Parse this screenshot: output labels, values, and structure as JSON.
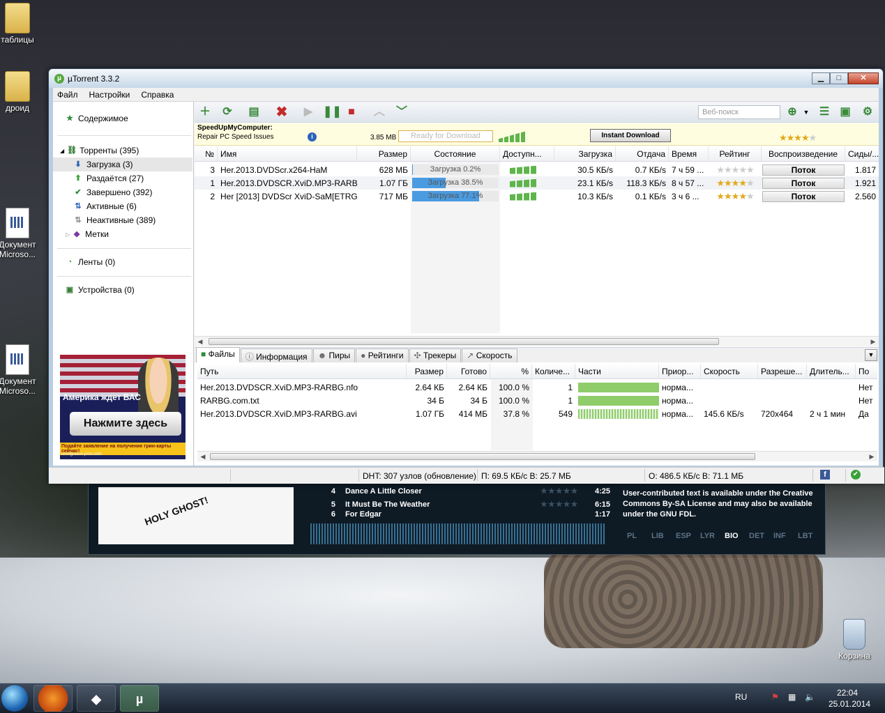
{
  "desktop": {
    "icons": [
      {
        "label": "таблицы"
      },
      {
        "label": "дроид"
      },
      {
        "label": "Документ Microso..."
      },
      {
        "label": "Документ Microso..."
      },
      {
        "label": "Корзина"
      }
    ]
  },
  "player": {
    "tracks": [
      {
        "num": "4",
        "title": "Dance A Little Closer",
        "duration": "4:25"
      },
      {
        "num": "5",
        "title": "It Must Be The Weather",
        "duration": "6:15"
      },
      {
        "num": "6",
        "title": "For Edgar",
        "duration": "1:17"
      }
    ],
    "bio_text": "User-contributed text is available under the Creative Commons By-SA License and may also be available under the GNU FDL.",
    "tabs": [
      "PL",
      "LIB",
      "ESP",
      "LYR",
      "BIO",
      "DET",
      "INF",
      "LBT"
    ],
    "active_tab": "BIO",
    "cover_text": "HOLY GHOST!"
  },
  "window": {
    "title": "µTorrent 3.3.2",
    "menu": [
      "Файл",
      "Настройки",
      "Справка"
    ],
    "search_placeholder": "Веб-поиск"
  },
  "sidebar": {
    "content": "Содержимое",
    "torrents": "Торренты (395)",
    "items": [
      {
        "label": "Загрузка (3)",
        "selected": true
      },
      {
        "label": "Раздаётся (27)"
      },
      {
        "label": "Завершено (392)"
      },
      {
        "label": "Активные (6)"
      },
      {
        "label": "Неактивные (389)"
      },
      {
        "label": "Метки"
      }
    ],
    "feeds": "Ленты (0)",
    "devices": "Устройства (0)",
    "ad": {
      "headline": "Америка ждет ВАС",
      "button": "Нажмите здесь",
      "footer": "Подайте заявление на получение грин-карты сейчас!",
      "site": "immigration-pros.com"
    }
  },
  "adbar": {
    "line1": "SpeedUpMyComputer:",
    "line2": "Repair PC Speed Issues",
    "size": "3.85 MB",
    "ready": "Ready for Download",
    "instant": "Instant Download",
    "rating": 4
  },
  "torrent_table": {
    "columns": [
      "№",
      "Имя",
      "Размер",
      "Состояние",
      "Доступн...",
      "Загрузка",
      "Отдача",
      "Время",
      "Рейтинг",
      "Воспроизведение",
      "Сиды/..."
    ],
    "rows": [
      {
        "num": "3",
        "name": "Her.2013.DVDScr.x264-HaM",
        "size": "628 МБ",
        "status": "Загрузка 0.2%",
        "progress": 0.002,
        "down": "30.5 КБ/s",
        "up": "0.7 КБ/s",
        "eta": "7 ч 59 ...",
        "rating": 0,
        "play": "Поток",
        "seeds": "1.817"
      },
      {
        "num": "1",
        "name": "Her.2013.DVDSCR.XviD.MP3-RARBG",
        "size": "1.07 ГБ",
        "status": "Загрузка 38.5%",
        "progress": 0.385,
        "down": "23.1 КБ/s",
        "up": "118.3 КБ/s",
        "eta": "8 ч 57 ...",
        "rating": 4,
        "play": "Поток",
        "seeds": "1.921"
      },
      {
        "num": "2",
        "name": "Her [2013] DVDScr XviD-SaM[ETRG]",
        "size": "717 МБ",
        "status": "Загрузка 77.1%",
        "progress": 0.771,
        "down": "10.3 КБ/s",
        "up": "0.1 КБ/s",
        "eta": "3 ч 6 ...",
        "rating": 4,
        "play": "Поток",
        "seeds": "2.560"
      }
    ]
  },
  "panel_tabs": [
    "Файлы",
    "Информация",
    "Пиры",
    "Рейтинги",
    "Трекеры",
    "Скорость"
  ],
  "files_table": {
    "columns": [
      "Путь",
      "Размер",
      "Готово",
      "%",
      "Количе...",
      "Части",
      "Приор...",
      "Скорость",
      "Разреше...",
      "Длитель...",
      "По"
    ],
    "rows": [
      {
        "path": "Her.2013.DVDSCR.XviD.MP3-RARBG.nfo",
        "size": "2.64 КБ",
        "done": "2.64 КБ",
        "pct": "100.0 %",
        "count": "1",
        "pieces": 1.0,
        "prio": "норма...",
        "speed": "",
        "res": "",
        "dur": "",
        "play": "Нет"
      },
      {
        "path": "RARBG.com.txt",
        "size": "34 Б",
        "done": "34 Б",
        "pct": "100.0 %",
        "count": "1",
        "pieces": 1.0,
        "prio": "норма...",
        "speed": "",
        "res": "",
        "dur": "",
        "play": "Нет"
      },
      {
        "path": "Her.2013.DVDSCR.XviD.MP3-RARBG.avi",
        "size": "1.07 ГБ",
        "done": "414 МБ",
        "pct": "37.8 %",
        "count": "549",
        "pieces": 0.378,
        "prio": "норма...",
        "speed": "145.6 КБ/s",
        "res": "720x464",
        "dur": "2 ч 1 мин",
        "play": "Да"
      }
    ]
  },
  "statusbar": {
    "dht": "DHT: 307 узлов  (обновление)",
    "download": "П: 69.5 КБ/с В: 25.7 МБ",
    "upload": "О: 486.5 КБ/с В: 71.1 МБ"
  },
  "taskbar": {
    "lang": "RU",
    "time": "22:04",
    "date": "25.01.2014"
  },
  "colors": {
    "progress": "#4a9be0",
    "green": "#5fb44b",
    "star": "#e3a81a"
  }
}
